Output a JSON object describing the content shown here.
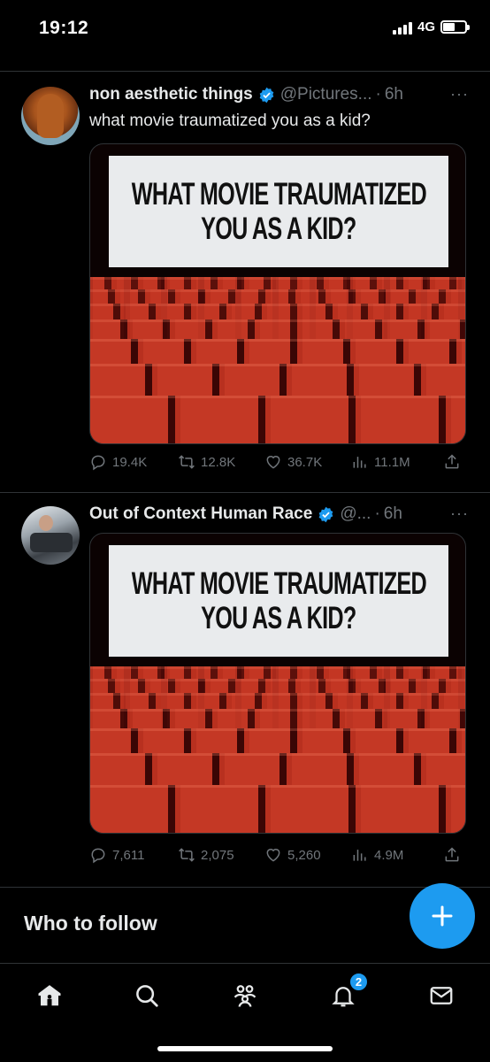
{
  "status_bar": {
    "time": "19:12",
    "network": "4G"
  },
  "tweets": [
    {
      "name": "non aesthetic things",
      "handle": "@Pictures...",
      "dot": "·",
      "time": "6h",
      "text": "what movie traumatized you as a kid?",
      "media": {
        "line1": "WHAT MOVIE TRAUMATIZED",
        "line2": "YOU AS A KID?"
      },
      "stats": {
        "replies": "19.4K",
        "retweets": "12.8K",
        "likes": "36.7K",
        "views": "11.1M"
      },
      "more": "···"
    },
    {
      "name": "Out of Context Human Race",
      "handle": "@...",
      "dot": "·",
      "time": "6h",
      "text": "",
      "media": {
        "line1": "WHAT MOVIE TRAUMATIZED",
        "line2": "YOU AS A KID?"
      },
      "stats": {
        "replies": "7,611",
        "retweets": "2,075",
        "likes": "5,260",
        "views": "4.9M"
      },
      "more": "···"
    }
  ],
  "who_to_follow": "Who to follow",
  "tabbar": {
    "notifications_badge": "2"
  },
  "colors": {
    "accent": "#1d9bf0",
    "muted": "#71767b",
    "text": "#e7e9ea",
    "background": "#000000"
  },
  "icons": [
    "reply-icon",
    "retweet-icon",
    "like-icon",
    "views-icon",
    "share-icon",
    "home-icon",
    "search-icon",
    "communities-icon",
    "notifications-icon",
    "messages-icon",
    "compose-icon",
    "verified-icon"
  ]
}
